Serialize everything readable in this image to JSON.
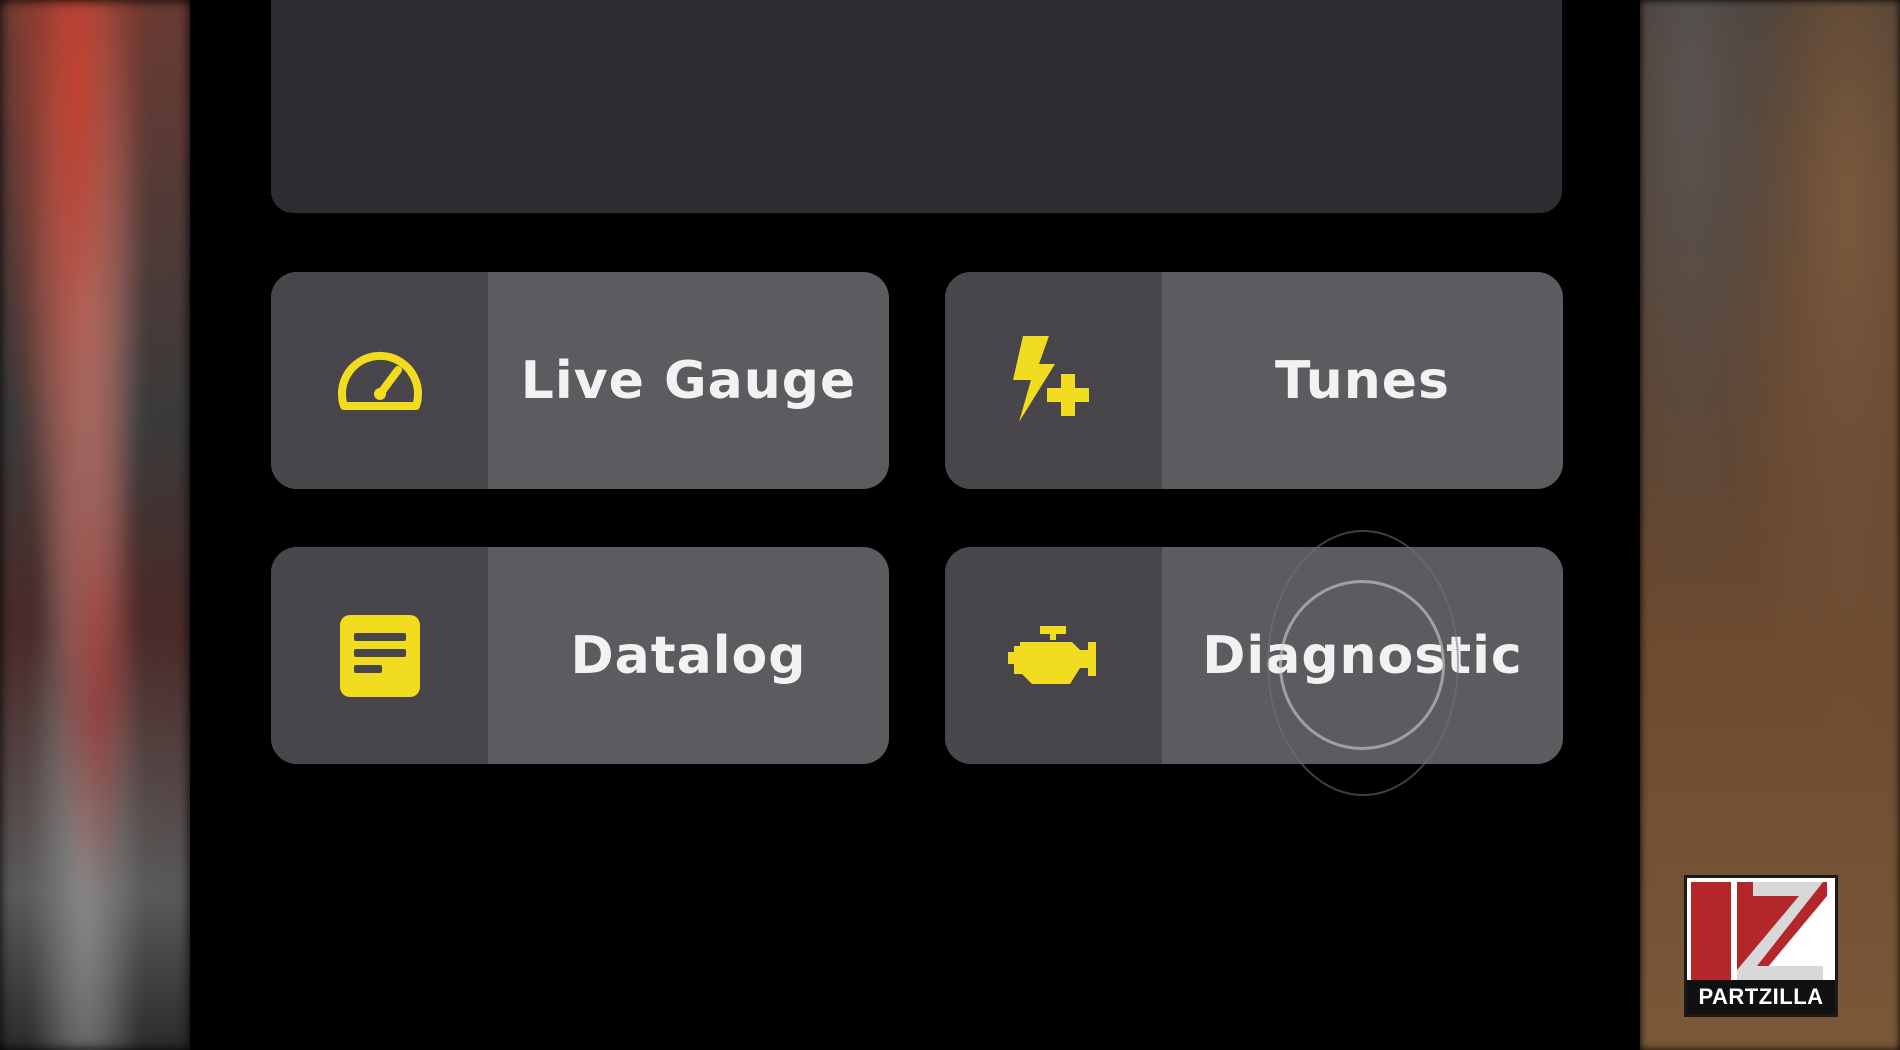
{
  "tiles": [
    {
      "label": "Live Gauge",
      "icon": "speedometer-icon"
    },
    {
      "label": "Tunes",
      "icon": "lightning-plus-icon"
    },
    {
      "label": "Datalog",
      "icon": "document-icon"
    },
    {
      "label": "Diagnostic",
      "icon": "engine-icon"
    }
  ],
  "watermark": {
    "text": "PARTZILLA"
  },
  "colors": {
    "accent": "#f2dc1f",
    "tile_bg": "#5d5b5f",
    "tile_icon_bg": "#48464a",
    "panel_bg": "#2f2c31",
    "label_text": "#f2f2f2",
    "logo_red": "#b3262a"
  }
}
